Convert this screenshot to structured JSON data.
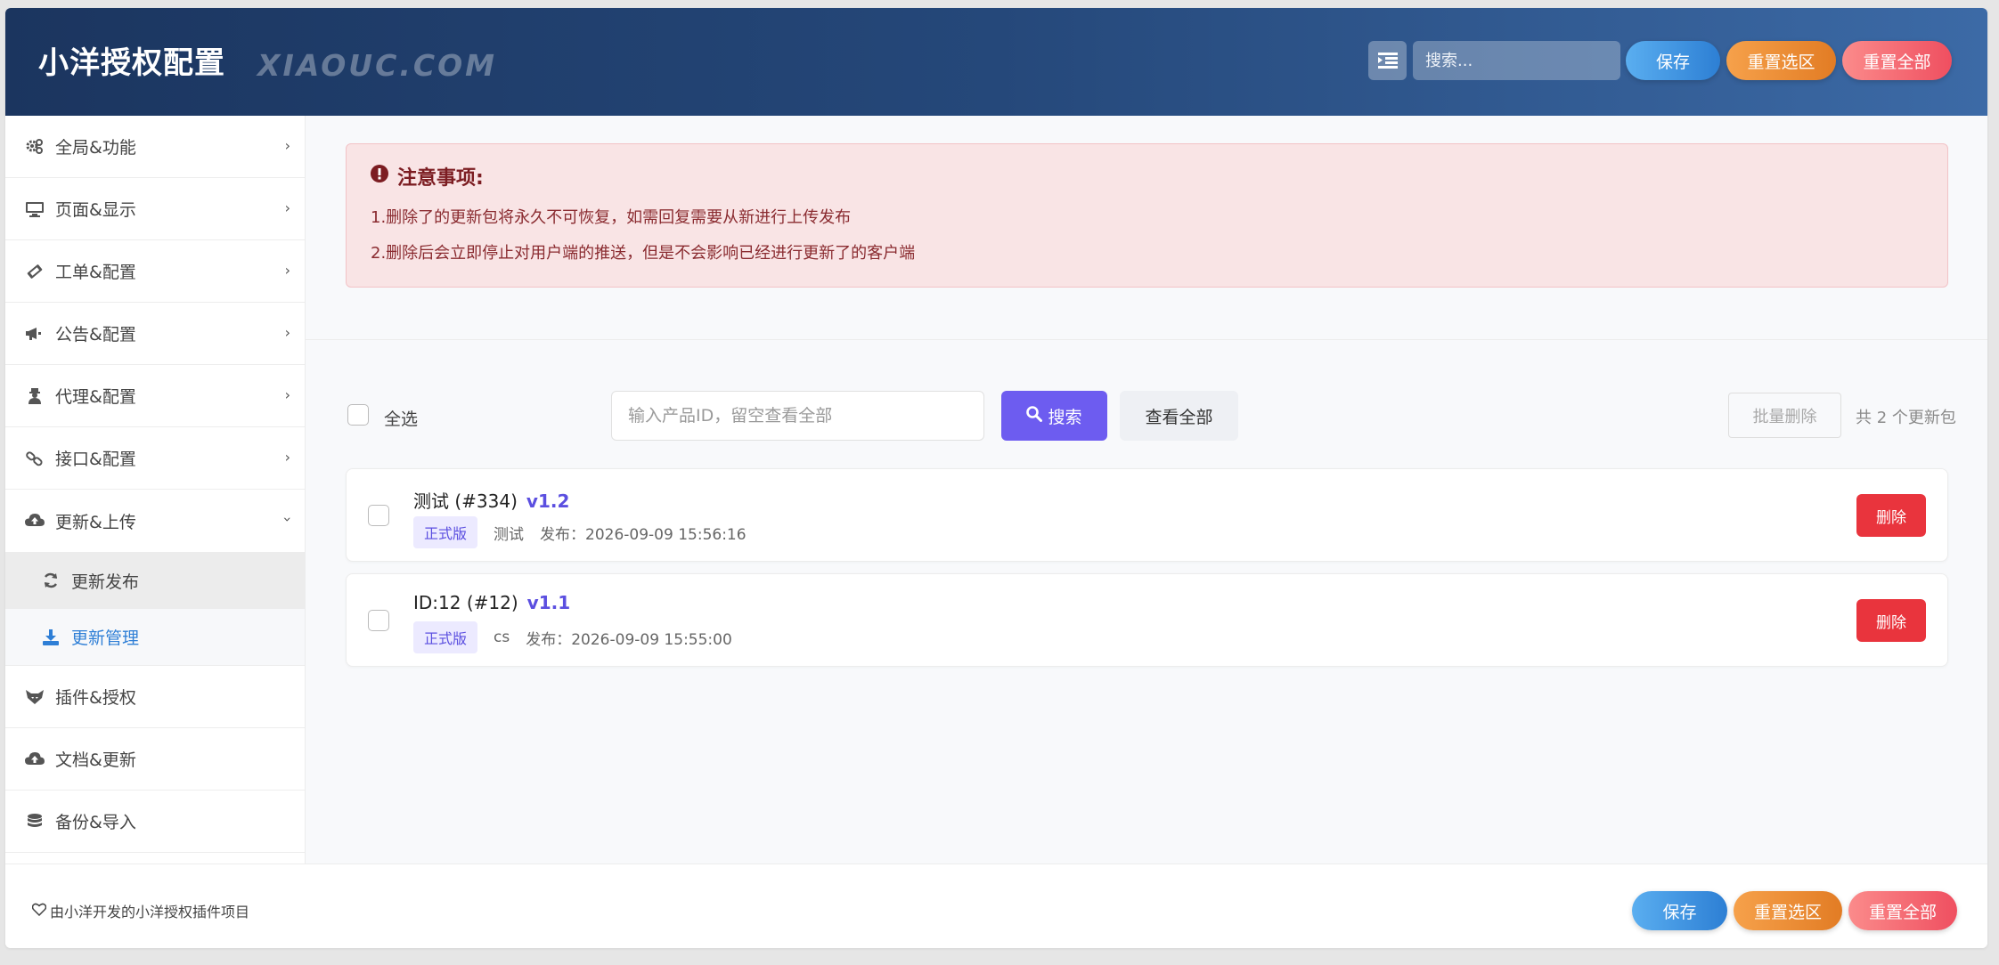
{
  "header": {
    "title": "小洋授权配置",
    "subtitle": "XIAOUC.COM",
    "search_placeholder": "搜索...",
    "save": "保存",
    "reset_section": "重置选区",
    "reset_all": "重置全部"
  },
  "sidebar": {
    "items": [
      {
        "label": "全局&功能",
        "icon": "gears-icon"
      },
      {
        "label": "页面&显示",
        "icon": "monitor-icon"
      },
      {
        "label": "工单&配置",
        "icon": "ticket-icon"
      },
      {
        "label": "公告&配置",
        "icon": "megaphone-icon"
      },
      {
        "label": "代理&配置",
        "icon": "user-secret-icon"
      },
      {
        "label": "接口&配置",
        "icon": "link-icon"
      },
      {
        "label": "更新&上传",
        "icon": "cloud-upload-icon"
      }
    ],
    "sub_items": [
      {
        "label": "更新发布",
        "icon": "refresh-icon"
      },
      {
        "label": "更新管理",
        "icon": "download-icon"
      }
    ],
    "items_after": [
      {
        "label": "插件&授权",
        "icon": "fox-icon"
      },
      {
        "label": "文档&更新",
        "icon": "cloud-upload-icon"
      },
      {
        "label": "备份&导入",
        "icon": "database-icon"
      }
    ]
  },
  "notice": {
    "title": "注意事项:",
    "line1": "1.删除了的更新包将永久不可恢复，如需回复需要从新进行上传发布",
    "line2": "2.删除后会立即停止对用户端的推送，但是不会影响已经进行更新了的客户端"
  },
  "toolbar": {
    "select_all": "全选",
    "input_placeholder": "输入产品ID，留空查看全部",
    "search": "搜索",
    "view_all": "查看全部",
    "batch_delete": "批量删除",
    "count_text": "共 2 个更新包"
  },
  "packages": [
    {
      "name": "测试 (#334)",
      "version": "v1.2",
      "tag": "正式版",
      "desc": "测试",
      "time": "发布：2026-09-09 15:56:16",
      "delete": "删除"
    },
    {
      "name": "ID:12 (#12)",
      "version": "v1.1",
      "tag": "正式版",
      "desc": "cs",
      "time": "发布：2026-09-09 15:55:00",
      "delete": "删除"
    }
  ],
  "footer": {
    "text": "由小洋开发的小洋授权插件项目",
    "save": "保存",
    "reset_section": "重置选区",
    "reset_all": "重置全部"
  },
  "colors": {
    "header_start": "#1b355f",
    "header_end": "#3c6aa6",
    "accent_purple": "#6d5cf0",
    "delete_red": "#e9343d",
    "active_blue": "#2f7fd6"
  }
}
